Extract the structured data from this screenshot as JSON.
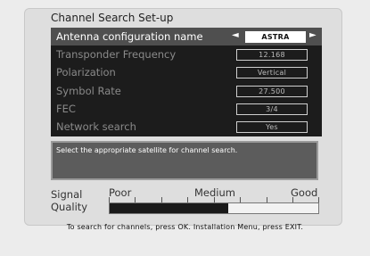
{
  "title": "Channel Search Set-up",
  "menu": [
    {
      "label": "Antenna configuration name",
      "value": "ASTRA",
      "active": true
    },
    {
      "label": "Transponder Frequency",
      "value": "12.168"
    },
    {
      "label": "Polarization",
      "value": "Vertical"
    },
    {
      "label": "Symbol Rate",
      "value": "27.500"
    },
    {
      "label": "FEC",
      "value": "3/4"
    },
    {
      "label": "Network search",
      "value": "Yes"
    }
  ],
  "arrows": {
    "left": "◄",
    "right": "►"
  },
  "help_text": "Select the appropriate satellite for channel search.",
  "signal": {
    "label_line1": "Signal",
    "label_line2": "Quality",
    "scale_poor": "Poor",
    "scale_medium": "Medium",
    "scale_good": "Good",
    "level": 0.57
  },
  "footer": "To search for channels, press OK. Installation Menu, press EXIT.",
  "colors": {
    "menu_bg": "#1c1c1c",
    "highlight_bg": "#4f4f4f",
    "help_bg": "#5c5c5c"
  }
}
